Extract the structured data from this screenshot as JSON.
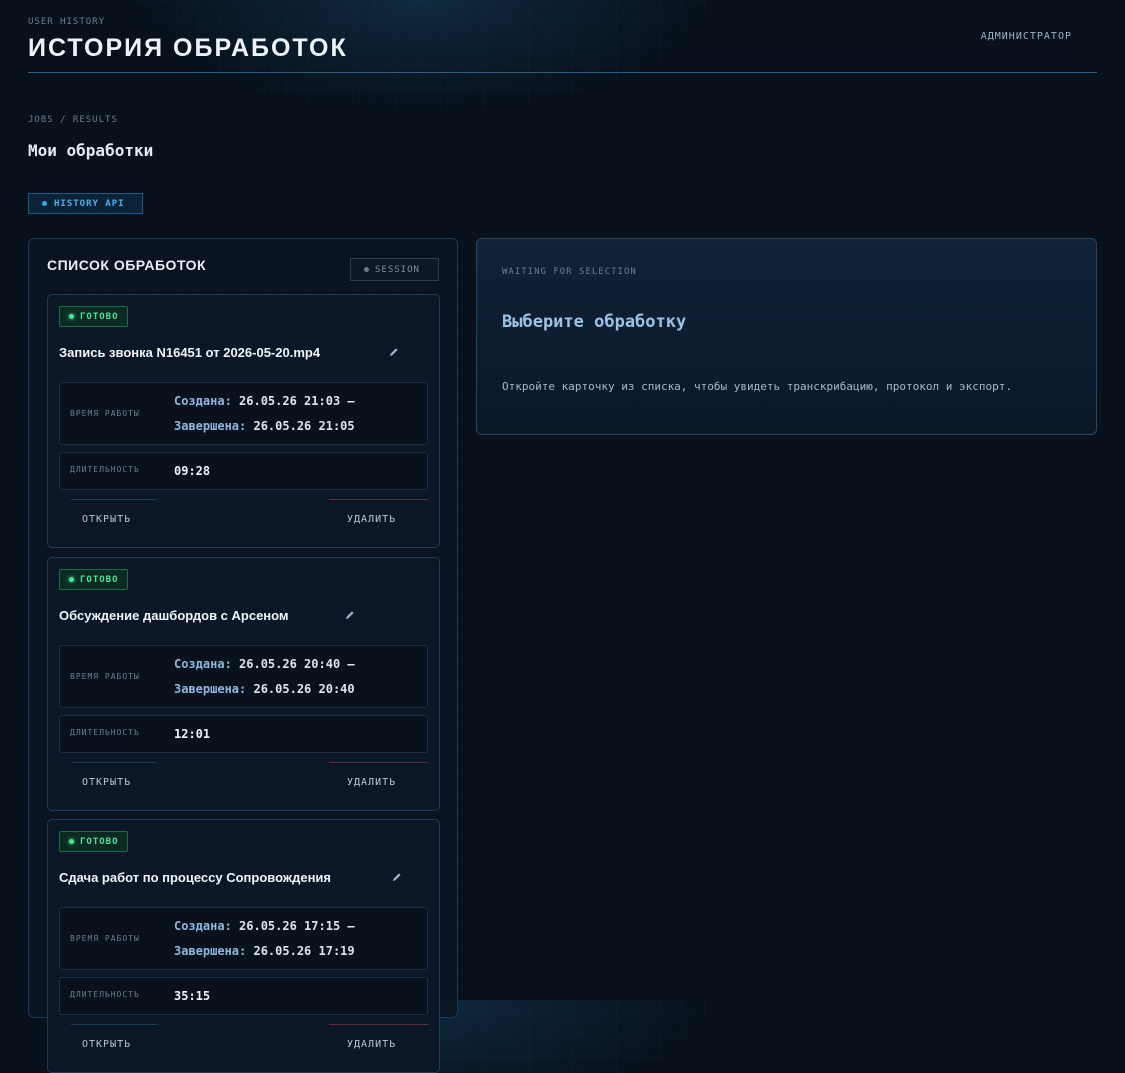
{
  "header": {
    "eyebrow": "USER HISTORY",
    "title": "ИСТОРИЯ ОБРАБОТОК",
    "role": "АДМИНИСТРАТОР"
  },
  "section": {
    "breadcrumb": "JOBS / RESULTS",
    "title": "Мои обработки",
    "api_badge": "HISTORY API"
  },
  "list": {
    "title": "СПИСОК ОБРАБОТОК",
    "session_badge": "SESSION",
    "labels": {
      "work_time": "ВРЕМЯ РАБОТЫ",
      "duration": "ДЛИТЕЛЬНОСТЬ",
      "created": "Создана:",
      "finished": "Завершена:",
      "open": "ОТКРЫТЬ",
      "delete": "УДАЛИТЬ"
    },
    "items": [
      {
        "status": "ГОТОВО",
        "title": "Запись звонка N16451 от 2026-05-20.mp4",
        "created": "26.05.26 21:03 —",
        "finished": "26.05.26 21:05",
        "duration": "09:28"
      },
      {
        "status": "ГОТОВО",
        "title": "Обсуждение дашбордов с Арсеном",
        "created": "26.05.26 20:40 —",
        "finished": "26.05.26 20:40",
        "duration": "12:01"
      },
      {
        "status": "ГОТОВО",
        "title": "Сдача работ по процессу Сопровождения",
        "created": "26.05.26 17:15 —",
        "finished": "26.05.26 17:19",
        "duration": "35:15"
      }
    ]
  },
  "detail": {
    "eyebrow": "WAITING FOR SELECTION",
    "title": "Выберите обработку",
    "description": "Откройте карточку из списка, чтобы увидеть транскрибацию, протокол и экспорт."
  },
  "colors": {
    "background": "#07101b",
    "accent": "#4fb1e8",
    "status_ok": "#4ee39a",
    "danger_line": "#5a2d3d"
  },
  "icons": {
    "edit": "pencil-icon",
    "status": "status-dot-icon"
  }
}
